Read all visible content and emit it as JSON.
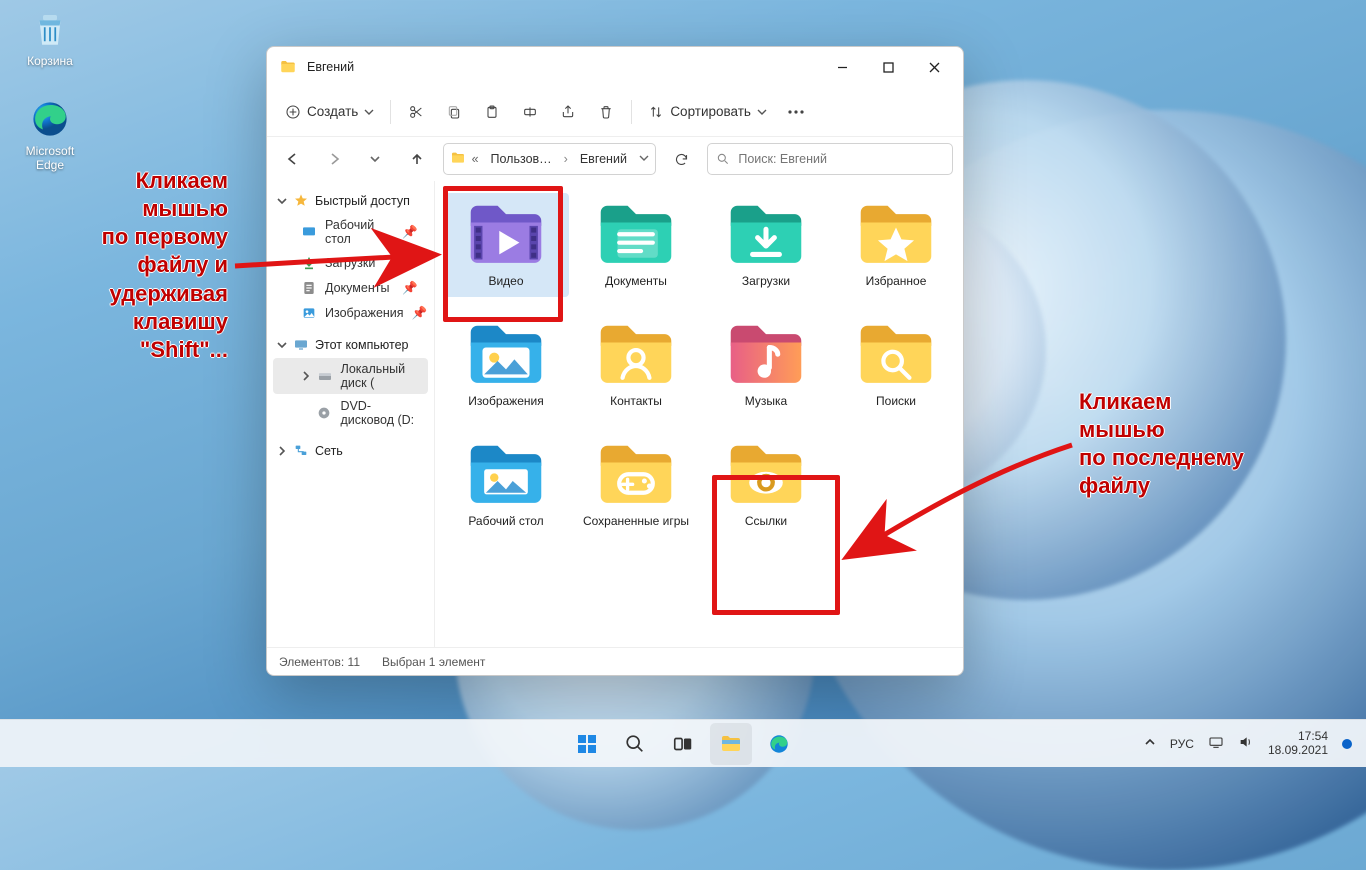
{
  "desktop": {
    "recycle_label": "Корзина",
    "edge_label": "Microsoft Edge"
  },
  "annotations": {
    "left": "Кликаем\nмышью\nпо первому\nфайлу и\nудерживая\nклавишу\n\"Shift\"...",
    "right": "Кликаем\nмышью\nпо последнему\nфайлу"
  },
  "window": {
    "title": "Евгений",
    "toolbar": {
      "create": "Создать",
      "sort": "Сортировать"
    },
    "breadcrumb": {
      "part1": "Пользов…",
      "part2": "Евгений"
    },
    "search_placeholder": "Поиск: Евгений",
    "sidebar": {
      "quick": "Быстрый доступ",
      "items_quick": [
        "Рабочий стол",
        "Загрузки",
        "Документы",
        "Изображения"
      ],
      "thispc": "Этот компьютер",
      "items_pc": [
        "Локальный диск (",
        "DVD-дисковод (D:"
      ],
      "network": "Сеть"
    },
    "folders": [
      {
        "label": "Видео",
        "kind": "video",
        "sel": true
      },
      {
        "label": "Документы",
        "kind": "docs"
      },
      {
        "label": "Загрузки",
        "kind": "downloads"
      },
      {
        "label": "Избранное",
        "kind": "fav"
      },
      {
        "label": "Изображения",
        "kind": "pics"
      },
      {
        "label": "Контакты",
        "kind": "contacts"
      },
      {
        "label": "Музыка",
        "kind": "music"
      },
      {
        "label": "Поиски",
        "kind": "search"
      },
      {
        "label": "Рабочий стол",
        "kind": "desktop"
      },
      {
        "label": "Сохраненные игры",
        "kind": "games"
      },
      {
        "label": "Ссылки",
        "kind": "links"
      }
    ],
    "status": {
      "count": "Элементов: 11",
      "sel": "Выбран 1 элемент"
    }
  },
  "taskbar": {
    "lang": "РУС",
    "time": "17:54",
    "date": "18.09.2021"
  }
}
